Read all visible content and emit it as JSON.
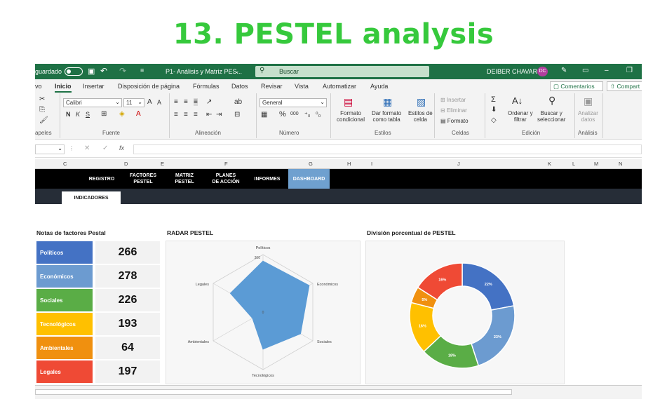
{
  "heading": "13. PESTEL analysis",
  "titlebar": {
    "autosave": "guardado",
    "filename": "P1- Análisis y Matriz PES...",
    "search_placeholder": "Buscar",
    "user": "DEIBER CHAVARRI",
    "initials": "DC"
  },
  "menu": {
    "items": [
      "vo",
      "Inicio",
      "Insertar",
      "Disposición de página",
      "Fórmulas",
      "Datos",
      "Revisar",
      "Vista",
      "Automatizar",
      "Ayuda"
    ],
    "comments": "Comentarios",
    "share": "Compart"
  },
  "ribbon": {
    "font_name": "Calibri",
    "font_size": "11",
    "number_format": "General",
    "groups": {
      "clipboard": "apeles",
      "font": "Fuente",
      "alignment": "Alineación",
      "number": "Número",
      "styles": "Estilos",
      "cells": "Celdas",
      "editing": "Edición",
      "analysis": "Análisis"
    },
    "cond_format": [
      "Formato",
      "condicional"
    ],
    "table_format": [
      "Dar formato",
      "como tabla"
    ],
    "cell_styles": [
      "Estilos de",
      "celda"
    ],
    "insert": "Insertar",
    "delete": "Eliminar",
    "format": "Formato",
    "sort": [
      "Ordenar y",
      "filtrar"
    ],
    "find": [
      "Buscar y",
      "seleccionar"
    ],
    "analyze": [
      "Analizar",
      "datos"
    ],
    "bold": "N",
    "italic": "K",
    "underline": "S",
    "grow_font": "A",
    "shrink_font": "A",
    "percent": "%",
    "thousands": "000"
  },
  "columns": [
    "C",
    "D",
    "E",
    "F",
    "G",
    "H",
    "I",
    "J",
    "K",
    "L",
    "M",
    "N"
  ],
  "nav": {
    "items": [
      {
        "l1": "REGISTRO",
        "l2": ""
      },
      {
        "l1": "FACTORES",
        "l2": "PESTEL"
      },
      {
        "l1": "MATRIZ",
        "l2": "PESTEL"
      },
      {
        "l1": "PLANES",
        "l2": "DE ACCIÓN"
      },
      {
        "l1": "INFORMES",
        "l2": ""
      },
      {
        "l1": "DASHBOARD",
        "l2": ""
      }
    ],
    "subtab": "INDICADORES"
  },
  "factors": {
    "title": "Notas de factores Pestal",
    "rows": [
      {
        "label": "Políticos",
        "value": "266",
        "color": "#4472c4"
      },
      {
        "label": "Económicos",
        "value": "278",
        "color": "#6c9bd0"
      },
      {
        "label": "Sociales",
        "value": "226",
        "color": "#5aad46"
      },
      {
        "label": "Tecnológicos",
        "value": "193",
        "color": "#ffc000"
      },
      {
        "label": "Ambientales",
        "value": "64",
        "color": "#f0900f"
      },
      {
        "label": "Legales",
        "value": "197",
        "color": "#ef4a35"
      }
    ]
  },
  "radar": {
    "title": "RADAR PESTEL",
    "axes": [
      "Políticos",
      "Económicos",
      "Sociales",
      "Tecnológicos",
      "Ambientales",
      "Legales"
    ],
    "values": [
      266,
      278,
      226,
      193,
      64,
      197
    ],
    "max_tick": "300",
    "zero_tick": "0",
    "color": "#5b9bd5"
  },
  "donut": {
    "title": "División porcentual de PESTEL",
    "slices": [
      {
        "name": "Políticos",
        "pct": 22,
        "color": "#4472c4"
      },
      {
        "name": "Económicos",
        "pct": 23,
        "color": "#6c9bd0"
      },
      {
        "name": "Sociales",
        "pct": 18,
        "color": "#5aad46"
      },
      {
        "name": "Tecnológicos",
        "pct": 16,
        "color": "#ffc000"
      },
      {
        "name": "Ambientales",
        "pct": 5,
        "color": "#f0900f"
      },
      {
        "name": "Legales",
        "pct": 16,
        "color": "#ef4a35"
      }
    ]
  }
}
